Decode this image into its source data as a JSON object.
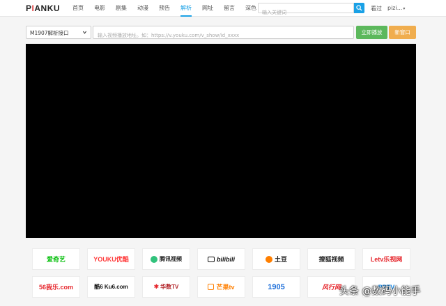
{
  "header": {
    "logo": {
      "main": "PIANKU",
      "accent_letter": "I"
    },
    "nav": [
      {
        "label": "首页",
        "name": "nav-home"
      },
      {
        "label": "电影",
        "name": "nav-movies"
      },
      {
        "label": "剧集",
        "name": "nav-series"
      },
      {
        "label": "动漫",
        "name": "nav-anime"
      },
      {
        "label": "预告",
        "name": "nav-trailers"
      },
      {
        "label": "解析",
        "name": "nav-parse",
        "active": true
      },
      {
        "label": "网址",
        "name": "nav-urls"
      },
      {
        "label": "留言",
        "name": "nav-messages"
      },
      {
        "label": "深色",
        "name": "nav-dark"
      }
    ],
    "search": {
      "placeholder": "输入关键词"
    },
    "history_label": "看过",
    "user_label": "pizi...",
    "accent_color": "#1aa1e6"
  },
  "toolbar": {
    "interface_select": "M1907解析接口",
    "url_placeholder": "输入视频播放地址。如：https://v.youku.com/v_show/id_xxxx",
    "play_button": "立即播放",
    "new_window_button": "新窗口"
  },
  "platforms": [
    {
      "name": "iqiyi",
      "label": "爱奇艺"
    },
    {
      "name": "youku",
      "label": "YOUKU优酷"
    },
    {
      "name": "tencent",
      "label": "腾讯视频"
    },
    {
      "name": "bilibili",
      "label": "bilibili"
    },
    {
      "name": "tudou",
      "label": "土豆"
    },
    {
      "name": "sohu",
      "label": "搜狐视频"
    },
    {
      "name": "letv",
      "label": "Letv乐视网"
    },
    {
      "name": "56",
      "label": "56我乐.com"
    },
    {
      "name": "ku6",
      "label": "酷6 Ku6.com"
    },
    {
      "name": "huashu",
      "label": "华数TV"
    },
    {
      "name": "mango",
      "label": "芒果tv"
    },
    {
      "name": "1905",
      "label": "1905"
    },
    {
      "name": "fengxing",
      "label": "风行网"
    },
    {
      "name": "pptv",
      "label": "PPTV"
    }
  ],
  "watermark": "头条 @数码小能手"
}
